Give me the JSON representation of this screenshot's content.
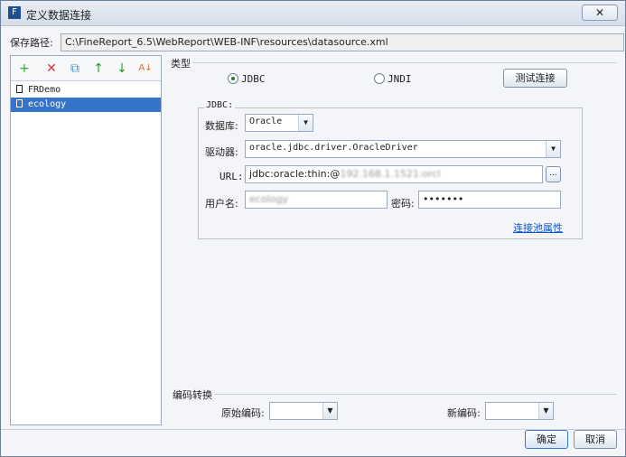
{
  "window": {
    "title": "定义数据连接",
    "close": "✕"
  },
  "save_path": {
    "label": "保存路径:",
    "value": "C:\\FineReport_6.5\\WebReport\\WEB-INF\\resources\\datasource.xml"
  },
  "toolbar": {
    "add": "+",
    "delete": "✕",
    "copy": "⧉",
    "up": "↑",
    "down": "↓",
    "sort": "A↓"
  },
  "connections": [
    {
      "name": "FRDemo",
      "selected": false
    },
    {
      "name": "ecology",
      "selected": true
    }
  ],
  "type_section": {
    "title": "类型",
    "jdbc": "JDBC",
    "jndi": "JNDI",
    "test_button": "测试连接"
  },
  "jdbc": {
    "legend": "JDBC:",
    "database_label": "数据库:",
    "database_value": "Oracle",
    "driver_label": "驱动器:",
    "driver_value": "oracle.jdbc.driver.OracleDriver",
    "url_label": "URL:",
    "url_value": "jdbc:oracle:thin:@",
    "url_hidden": "192.168.1.1521:orcl",
    "user_label": "用户名:",
    "user_value": "ecology",
    "password_label": "密码:",
    "password_value": "•••••••",
    "pool_link": "连接池属性"
  },
  "encoding": {
    "title": "编码转换",
    "original_label": "原始编码:",
    "new_label": "新编码:"
  },
  "footer": {
    "ok": "确定",
    "cancel": "取消"
  }
}
